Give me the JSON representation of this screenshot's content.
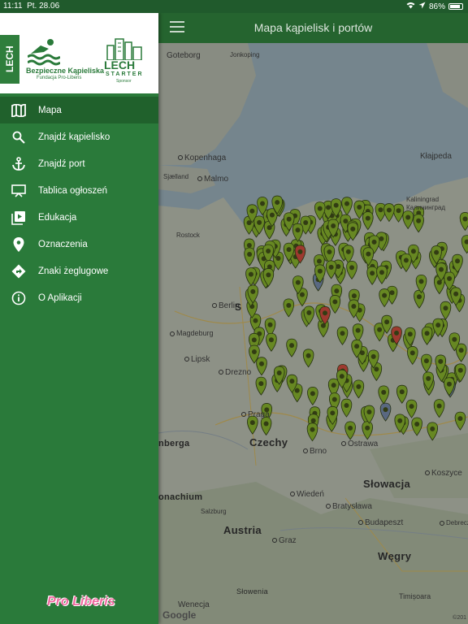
{
  "status_bar": {
    "time": "11:11",
    "date": "Pt. 28.06",
    "battery": "86%",
    "battery_level": 0.86
  },
  "app_bar": {
    "title": "Mapa kąpielisk i portów",
    "menu_icon": "hamburger-icon"
  },
  "drawer": {
    "logos": {
      "lech_strip": "LECH",
      "main_title": "Bezpieczne Kąpieliska",
      "main_subtitle": "Fundacja Pro-Liberis",
      "sponsor_name_1": "LECH",
      "sponsor_name_2": "STARTER",
      "sponsor_label": "Sponsor"
    },
    "items": [
      {
        "label": "Mapa",
        "icon": "map-icon",
        "active": true
      },
      {
        "label": "Znajdź kąpielisko",
        "icon": "search-icon",
        "active": false
      },
      {
        "label": "Znajdź port",
        "icon": "anchor-icon",
        "active": false
      },
      {
        "label": "Tablica ogłoszeń",
        "icon": "presentation-board-icon",
        "active": false
      },
      {
        "label": "Edukacja",
        "icon": "video-library-icon",
        "active": false
      },
      {
        "label": "Oznaczenia",
        "icon": "location-pin-icon",
        "active": false
      },
      {
        "label": "Znaki żeglugowe",
        "icon": "directions-icon",
        "active": false
      },
      {
        "label": "O Aplikacji",
        "icon": "info-icon",
        "active": false
      }
    ],
    "footer_logo": "Pro Liberis"
  },
  "map": {
    "cities": [
      "Goteborg",
      "Jonkoping",
      "Kopenhaga",
      "Sjælland",
      "Malmo",
      "Kłajpeda",
      "Kaliningrad",
      "Калининград",
      "Rostock",
      "Berlin",
      "Magdeburg",
      "Lipsk",
      "Drezno",
      "Praga",
      "Brno",
      "Ostrawa",
      "Wiedeń",
      "Bratysława",
      "Budapeszt",
      "Salzburg",
      "Graz",
      "Koszyce",
      "Debreczyn",
      "Wenecja",
      "Timișoara"
    ],
    "countries": [
      "Czechy",
      "Słowacja",
      "Austria",
      "Węgry",
      "Słowenia"
    ],
    "partial_labels": [
      "nberga",
      "onachium",
      "S"
    ],
    "attribution": "Google",
    "copyright": "©201"
  }
}
